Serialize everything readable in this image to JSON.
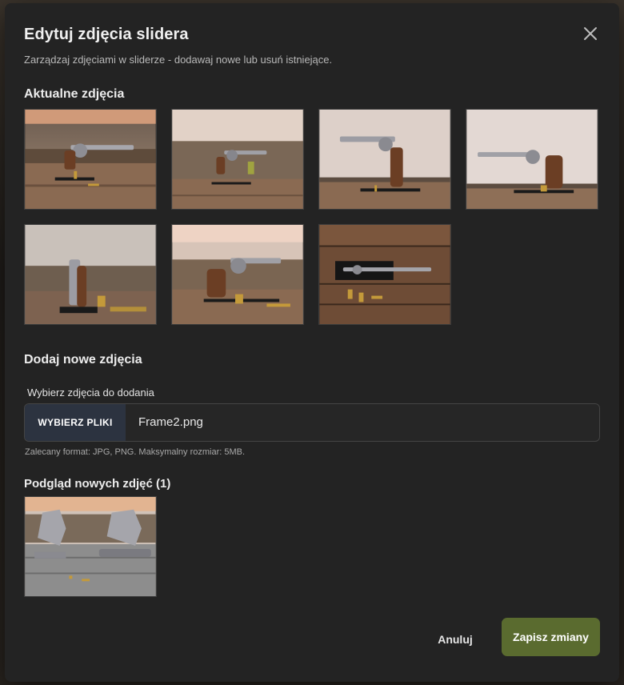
{
  "dialog": {
    "title": "Edytuj zdjęcia slidera",
    "subtitle": "Zarządzaj zdjęciami w sliderze - dodawaj nowe lub usuń istniejące.",
    "close_icon": "close-icon"
  },
  "current_images": {
    "heading": "Aktualne zdjęcia",
    "count": 7
  },
  "add_images": {
    "heading": "Dodaj nowe zdjęcia",
    "label": "Wybierz zdjęcia do dodania",
    "button_label": "WYBIERZ PLIKI",
    "selected_file": "Frame2.png",
    "hint": "Zalecany format: JPG, PNG. Maksymalny rozmiar: 5MB."
  },
  "preview": {
    "heading": "Podgląd nowych zdjęć (1)",
    "count": 1
  },
  "actions": {
    "cancel_label": "Anuluj",
    "save_label": "Zapisz zmiany"
  },
  "colors": {
    "modal_bg": "#232323",
    "accent_save": "#5a6b2f",
    "file_button_bg": "#2c3340"
  }
}
